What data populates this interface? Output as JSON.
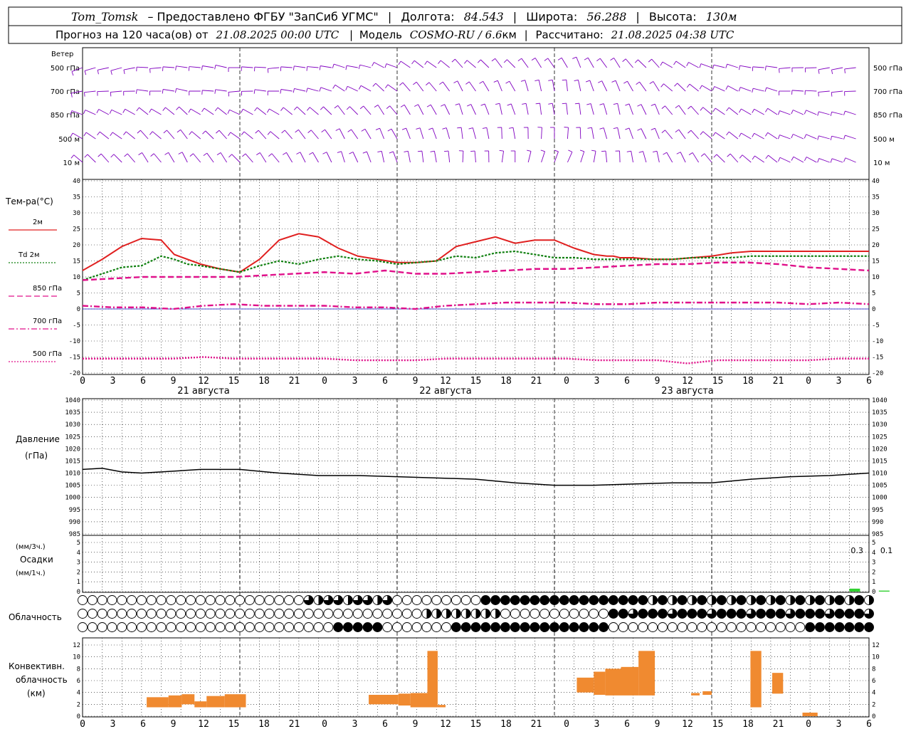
{
  "header": {
    "station": "Tom_Tomsk",
    "provided": "– Предоставлено ФГБУ \"ЗапСиб УГМС\"",
    "lon_label": "Долгота:",
    "lon": "84.543",
    "lat_label": "Широта:",
    "lat": "56.288",
    "alt_label": "Высота:",
    "alt": "130м",
    "forecast_prefix": "Прогноз на 120 часа(ов) от",
    "forecast_from": "21.08.2025 00:00 UTC",
    "model_label": "Модель",
    "model": "COSMO-RU / 6.6",
    "model_unit": "км",
    "calc_label": "Рассчитано:",
    "calc": "21.08.2025 04:38 UTC"
  },
  "x_ticks": [
    "0",
    "3",
    "6",
    "9",
    "12",
    "15",
    "18",
    "21",
    "0",
    "3",
    "6",
    "9",
    "12",
    "15",
    "18",
    "21",
    "0",
    "3",
    "6",
    "9",
    "12",
    "15",
    "18",
    "21",
    "0",
    "3",
    "6"
  ],
  "days": [
    "21 августа",
    "22 августа",
    "23 августа"
  ],
  "wind": {
    "title": "Ветер",
    "levels": [
      "500 гПа",
      "700 гПа",
      "850 гПа",
      "500 м",
      "10 м"
    ],
    "color": "#8000c0"
  },
  "temperature": {
    "title": "Тем-ра(°C)",
    "yticks": [
      "40",
      "35",
      "30",
      "25",
      "20",
      "15",
      "10",
      "5",
      "0",
      "-5",
      "-10",
      "-15",
      "-20"
    ],
    "legend": [
      {
        "label": "2м",
        "color": "#e02020",
        "style": "solid"
      },
      {
        "label": "Td 2м",
        "color": "#108010",
        "style": "dotted"
      },
      {
        "label": "850 гПа",
        "color": "#e0108a",
        "style": "dashed"
      },
      {
        "label": "700 гПа",
        "color": "#e0108a",
        "style": "dashdot"
      },
      {
        "label": "500 гПа",
        "color": "#e0108a",
        "style": "dotted"
      }
    ]
  },
  "pressure": {
    "title": "Давление",
    "unit": "(гПа)",
    "yticks": [
      "1040",
      "1035",
      "1030",
      "1025",
      "1020",
      "1015",
      "1010",
      "1005",
      "1000",
      "995",
      "990",
      "985"
    ]
  },
  "precip": {
    "unit1": "(мм/3ч.)",
    "title": "Осадки",
    "unit2": "(мм/1ч.)",
    "yticks": [
      "5",
      "4",
      "3",
      "2",
      "1",
      "0"
    ],
    "labels": [
      "0.3",
      "0.1"
    ],
    "color": "#30d030"
  },
  "cloud": {
    "title": "Облачность"
  },
  "convective": {
    "title1": "Конвективн.",
    "title2": "облачность",
    "unit": "(км)",
    "yticks": [
      "12",
      "10",
      "8",
      "6",
      "4",
      "2",
      "0"
    ],
    "color": "#f08a30"
  },
  "chart_data": [
    {
      "type": "line",
      "title": "Тем-ра(°C)",
      "x_unit": "hours from 21.08.2025 00:00 UTC",
      "ylim": [
        -20,
        40
      ],
      "x": [
        0,
        3,
        6,
        9,
        12,
        14,
        16,
        18,
        21,
        24,
        27,
        30,
        33,
        36,
        39,
        42,
        45,
        48,
        51,
        54,
        57,
        60,
        63,
        66,
        69,
        72,
        75,
        78,
        80,
        81,
        82,
        84,
        87,
        90,
        93,
        96,
        99,
        102,
        105,
        108,
        111,
        114,
        117,
        120
      ],
      "series": [
        {
          "name": "2м",
          "values": [
            12,
            15.5,
            19.5,
            22,
            21.5,
            17,
            15.5,
            14,
            12.5,
            11.5,
            15.5,
            21.5,
            23.5,
            22.5,
            19,
            16.5,
            15.5,
            14.5,
            14.5,
            15,
            19.5,
            21,
            22.5,
            20.5,
            21.5,
            21.5,
            19,
            17,
            16.5,
            16.5,
            16,
            16,
            15.5,
            15.5,
            16,
            16.5,
            17.5,
            18,
            18,
            18,
            18,
            18,
            18,
            18
          ]
        },
        {
          "name": "Td 2м",
          "values": [
            9,
            11,
            13,
            13.5,
            16.5,
            15.5,
            14,
            13.5,
            12.5,
            11.5,
            13.5,
            15,
            14,
            15.5,
            16.5,
            15.5,
            15,
            14,
            14.5,
            15,
            16.5,
            16,
            17.5,
            18,
            17,
            16,
            16,
            15.5,
            15.5,
            15.5,
            15.5,
            15.5,
            15.5,
            15.5,
            16,
            16,
            16,
            16.5,
            16.5,
            16.5,
            16.5,
            16.5,
            16.5,
            16.5
          ]
        }
      ]
    },
    {
      "type": "line",
      "title": "Давление (гПа)",
      "ylim": [
        985,
        1040
      ],
      "x": [
        0,
        3,
        6,
        9,
        12,
        18,
        24,
        30,
        36,
        42,
        48,
        54,
        60,
        66,
        72,
        78,
        84,
        90,
        96,
        102,
        108,
        114,
        120
      ],
      "series": [
        {
          "values": [
            1011.5,
            1012,
            1010.5,
            1010,
            1010.5,
            1011.5,
            1011.5,
            1010,
            1009,
            1009,
            1008.5,
            1008,
            1007.5,
            1006,
            1005,
            1005,
            1005.5,
            1006,
            1006,
            1007.5,
            1008.5,
            1009,
            1010
          ]
        }
      ]
    },
    {
      "type": "bar",
      "title": "Осадки",
      "x": [
        117,
        121.5
      ],
      "values": [
        0.3,
        0.1
      ],
      "ylim": [
        0,
        5
      ]
    },
    {
      "type": "bar",
      "title": "Конвективн. облачность (км)",
      "ylim": [
        0,
        12
      ]
    }
  ]
}
